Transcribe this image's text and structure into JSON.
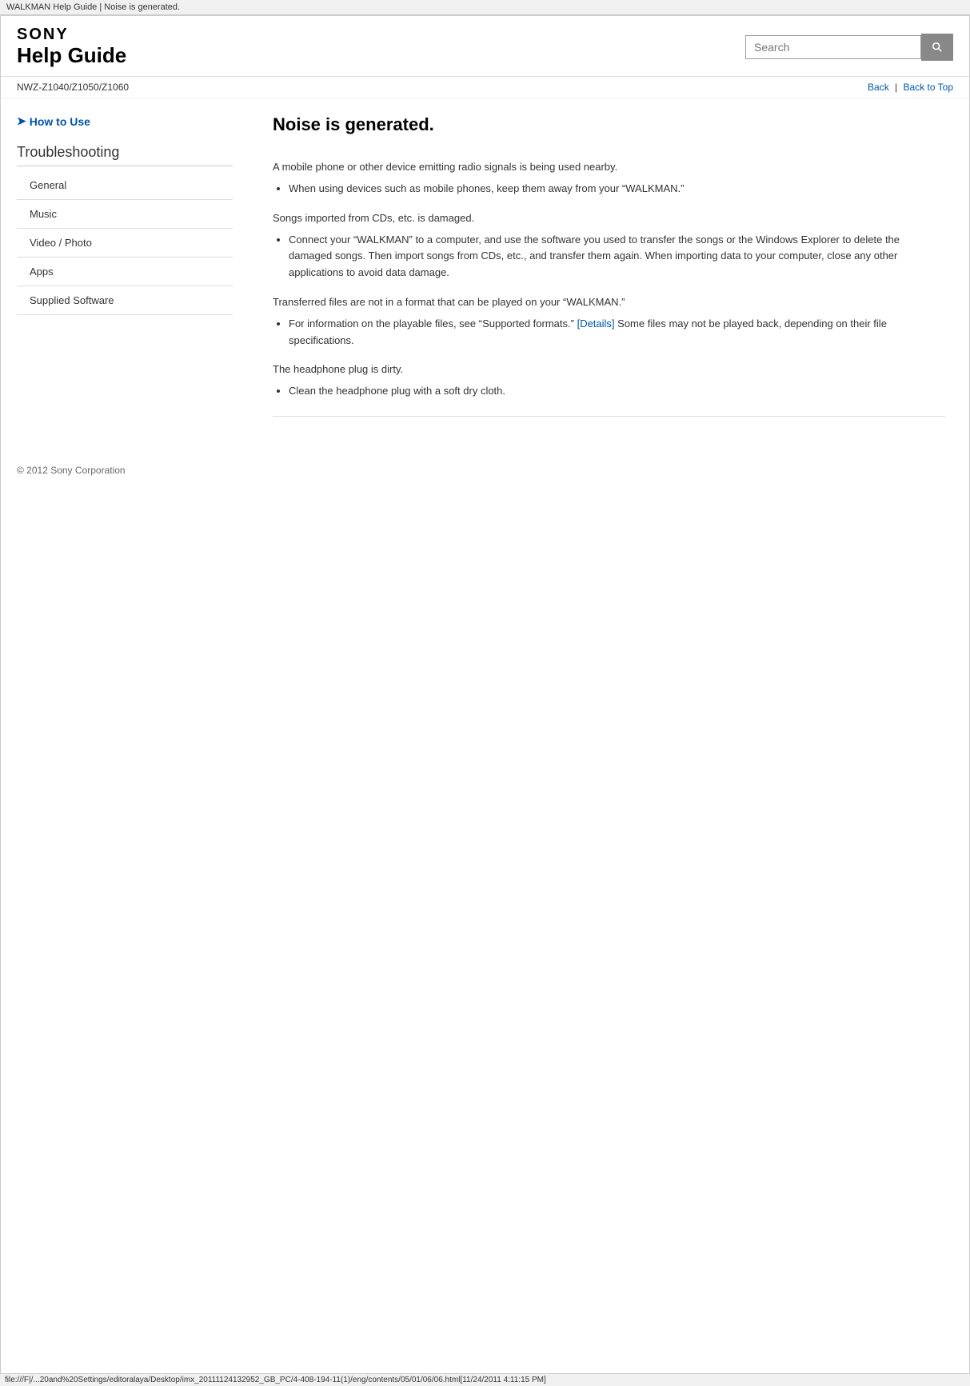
{
  "browser": {
    "title": "WALKMAN Help Guide | Noise is generated."
  },
  "header": {
    "sony_logo": "SONY",
    "help_guide_title": "Help Guide",
    "search_placeholder": "Search"
  },
  "navbar": {
    "model_number": "NWZ-Z1040/Z1050/Z1060",
    "back_label": "Back",
    "back_to_top_label": "Back to Top"
  },
  "sidebar": {
    "how_to_use_label": "How to Use",
    "troubleshooting_label": "Troubleshooting",
    "items": [
      {
        "label": "General"
      },
      {
        "label": "Music"
      },
      {
        "label": "Video / Photo"
      },
      {
        "label": "Apps"
      },
      {
        "label": "Supplied Software"
      }
    ]
  },
  "content": {
    "page_title": "Noise is generated.",
    "sections": [
      {
        "paragraph": "A mobile phone or other device emitting radio signals is being used nearby.",
        "bullets": [
          "When using devices such as mobile phones, keep them away from your “WALKMAN.”"
        ]
      },
      {
        "paragraph": "Songs imported from CDs, etc. is damaged.",
        "bullets": [
          "Connect your “WALKMAN” to a computer, and use the software you used to transfer the songs or the Windows Explorer to delete the damaged songs. Then import songs from CDs, etc., and transfer them again. When importing data to your computer, close any other applications to avoid data damage."
        ]
      },
      {
        "paragraph": "Transferred files are not in a format that can be played on your “WALKMAN.”",
        "bullets": [
          "For information on the playable files, see “Supported formats.” [Details] Some files may not be played back, depending on their file specifications."
        ]
      },
      {
        "paragraph": "The headphone plug is dirty.",
        "bullets": [
          "Clean the headphone plug with a soft dry cloth."
        ]
      }
    ]
  },
  "footer": {
    "copyright": "© 2012 Sony Corporation"
  },
  "bottom_bar": {
    "url": "file:///F|/...20and%20Settings/editoralaya/Desktop/imx_20111124132952_GB_PC/4-408-194-11(1)/eng/contents/05/01/06/06.html[11/24/2011 4:11:15 PM]"
  }
}
